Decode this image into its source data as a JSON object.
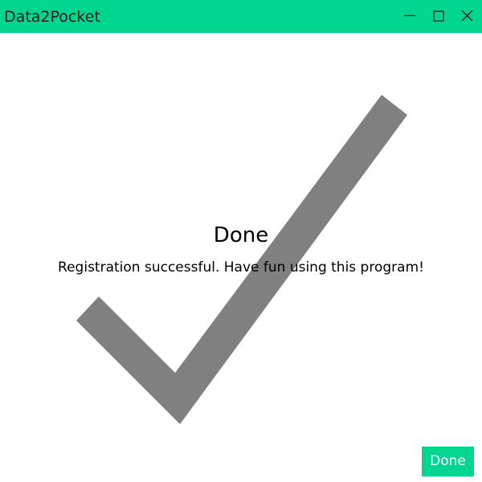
{
  "window": {
    "title": "Data2Pocket"
  },
  "titlebar": {
    "minimize_icon": "minimize-icon",
    "maximize_icon": "maximize-icon",
    "close_icon": "close-icon"
  },
  "status": {
    "icon": "checkmark-icon",
    "title": "Done",
    "message": "Registration successful. Have fun using this program!"
  },
  "footer": {
    "done_label": "Done"
  },
  "colors": {
    "accent": "#00d68f",
    "checkmark": "#808080",
    "text": "#000000",
    "button_text": "#ffffff"
  }
}
